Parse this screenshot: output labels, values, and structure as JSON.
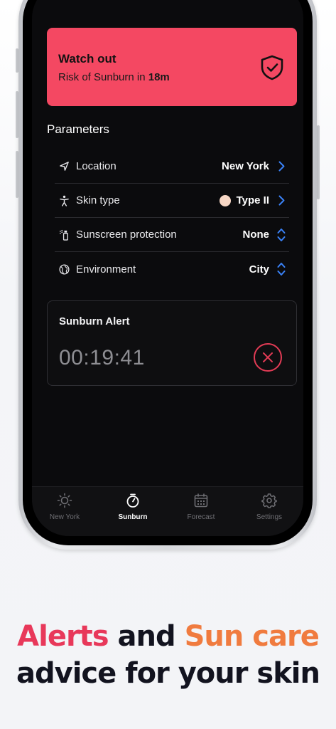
{
  "alert": {
    "title": "Watch out",
    "subtitle_prefix": "Risk of Sunburn in",
    "subtitle_time": "18m",
    "color": "#f44862"
  },
  "parameters": {
    "title": "Parameters",
    "rows": [
      {
        "label": "Location",
        "value": "New York",
        "icon": "location-arrow-icon",
        "control": "chevron-right-icon"
      },
      {
        "label": "Skin type",
        "value": "Type II",
        "icon": "person-icon",
        "control": "chevron-right-icon"
      },
      {
        "label": "Sunscreen protection",
        "value": "None",
        "icon": "spray-bottle-icon",
        "control": "chevron-up-down-icon"
      },
      {
        "label": "Environment",
        "value": "City",
        "icon": "globe-icon",
        "control": "chevron-up-down-icon"
      }
    ]
  },
  "timer": {
    "title": "Sunburn Alert",
    "value": "00:19:41"
  },
  "tabs": [
    {
      "label": "New York",
      "icon": "sun-icon",
      "active": false
    },
    {
      "label": "Sunburn",
      "icon": "stopwatch-icon",
      "active": true
    },
    {
      "label": "Forecast",
      "icon": "calendar-icon",
      "active": false
    },
    {
      "label": "Settings",
      "icon": "gear-icon",
      "active": false
    }
  ],
  "headline": {
    "word1": "Alerts",
    "word2": "and",
    "word3": "Sun care",
    "line2": "advice for your skin"
  },
  "colors": {
    "accent_blue": "#3a82f7",
    "accent_red": "#e8385a",
    "accent_orange": "#f07b3f"
  }
}
